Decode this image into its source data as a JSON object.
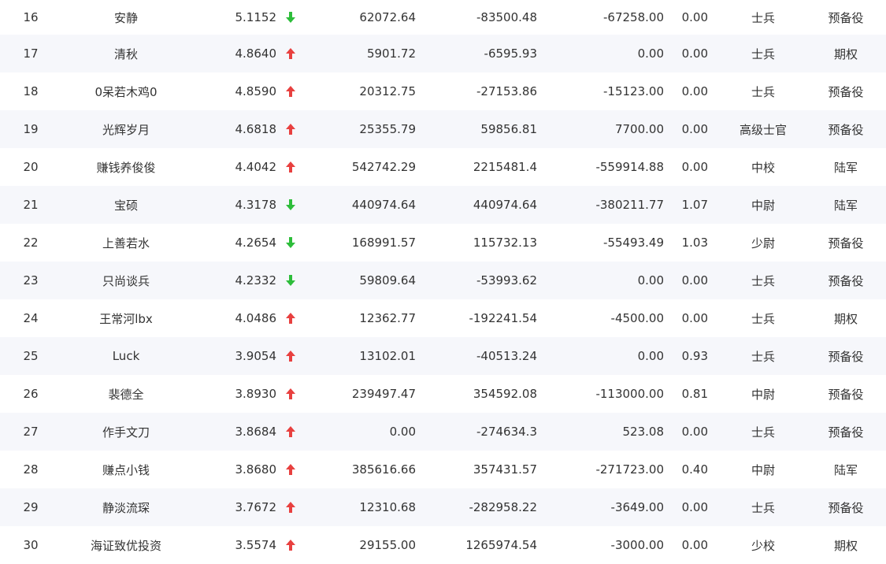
{
  "colors": {
    "up": "#e8403f",
    "down": "#2dbd3a",
    "alt_row_bg": "#f6f7fb",
    "text": "#333333"
  },
  "rows": [
    {
      "rank": "16",
      "name": "安静",
      "score": "5.1152",
      "trend": "down",
      "v1": "62072.64",
      "v2": "-83500.48",
      "v3": "-67258.00",
      "v4": "0.00",
      "level": "士兵",
      "category": "预备役"
    },
    {
      "rank": "17",
      "name": "清秋",
      "score": "4.8640",
      "trend": "up",
      "v1": "5901.72",
      "v2": "-6595.93",
      "v3": "0.00",
      "v4": "0.00",
      "level": "士兵",
      "category": "期权"
    },
    {
      "rank": "18",
      "name": "0呆若木鸡0",
      "score": "4.8590",
      "trend": "up",
      "v1": "20312.75",
      "v2": "-27153.86",
      "v3": "-15123.00",
      "v4": "0.00",
      "level": "士兵",
      "category": "预备役"
    },
    {
      "rank": "19",
      "name": "光辉岁月",
      "score": "4.6818",
      "trend": "up",
      "v1": "25355.79",
      "v2": "59856.81",
      "v3": "7700.00",
      "v4": "0.00",
      "level": "高级士官",
      "category": "预备役"
    },
    {
      "rank": "20",
      "name": "赚钱养俊俊",
      "score": "4.4042",
      "trend": "up",
      "v1": "542742.29",
      "v2": "2215481.4",
      "v3": "-559914.88",
      "v4": "0.00",
      "level": "中校",
      "category": "陆军"
    },
    {
      "rank": "21",
      "name": "宝硕",
      "score": "4.3178",
      "trend": "down",
      "v1": "440974.64",
      "v2": "440974.64",
      "v3": "-380211.77",
      "v4": "1.07",
      "level": "中尉",
      "category": "陆军"
    },
    {
      "rank": "22",
      "name": "上善若水",
      "score": "4.2654",
      "trend": "down",
      "v1": "168991.57",
      "v2": "115732.13",
      "v3": "-55493.49",
      "v4": "1.03",
      "level": "少尉",
      "category": "预备役"
    },
    {
      "rank": "23",
      "name": "只尚谈兵",
      "score": "4.2332",
      "trend": "down",
      "v1": "59809.64",
      "v2": "-53993.62",
      "v3": "0.00",
      "v4": "0.00",
      "level": "士兵",
      "category": "预备役"
    },
    {
      "rank": "24",
      "name": "王常河lbx",
      "score": "4.0486",
      "trend": "up",
      "v1": "12362.77",
      "v2": "-192241.54",
      "v3": "-4500.00",
      "v4": "0.00",
      "level": "士兵",
      "category": "期权"
    },
    {
      "rank": "25",
      "name": "Luck",
      "score": "3.9054",
      "trend": "up",
      "v1": "13102.01",
      "v2": "-40513.24",
      "v3": "0.00",
      "v4": "0.93",
      "level": "士兵",
      "category": "预备役"
    },
    {
      "rank": "26",
      "name": "裴德全",
      "score": "3.8930",
      "trend": "up",
      "v1": "239497.47",
      "v2": "354592.08",
      "v3": "-113000.00",
      "v4": "0.81",
      "level": "中尉",
      "category": "预备役"
    },
    {
      "rank": "27",
      "name": "作手文刀",
      "score": "3.8684",
      "trend": "up",
      "v1": "0.00",
      "v2": "-274634.3",
      "v3": "523.08",
      "v4": "0.00",
      "level": "士兵",
      "category": "预备役"
    },
    {
      "rank": "28",
      "name": "赚点小钱",
      "score": "3.8680",
      "trend": "up",
      "v1": "385616.66",
      "v2": "357431.57",
      "v3": "-271723.00",
      "v4": "0.40",
      "level": "中尉",
      "category": "陆军"
    },
    {
      "rank": "29",
      "name": "静淡流琛",
      "score": "3.7672",
      "trend": "up",
      "v1": "12310.68",
      "v2": "-282958.22",
      "v3": "-3649.00",
      "v4": "0.00",
      "level": "士兵",
      "category": "预备役"
    },
    {
      "rank": "30",
      "name": "海证致优投资",
      "score": "3.5574",
      "trend": "up",
      "v1": "29155.00",
      "v2": "1265974.54",
      "v3": "-3000.00",
      "v4": "0.00",
      "level": "少校",
      "category": "期权"
    }
  ]
}
